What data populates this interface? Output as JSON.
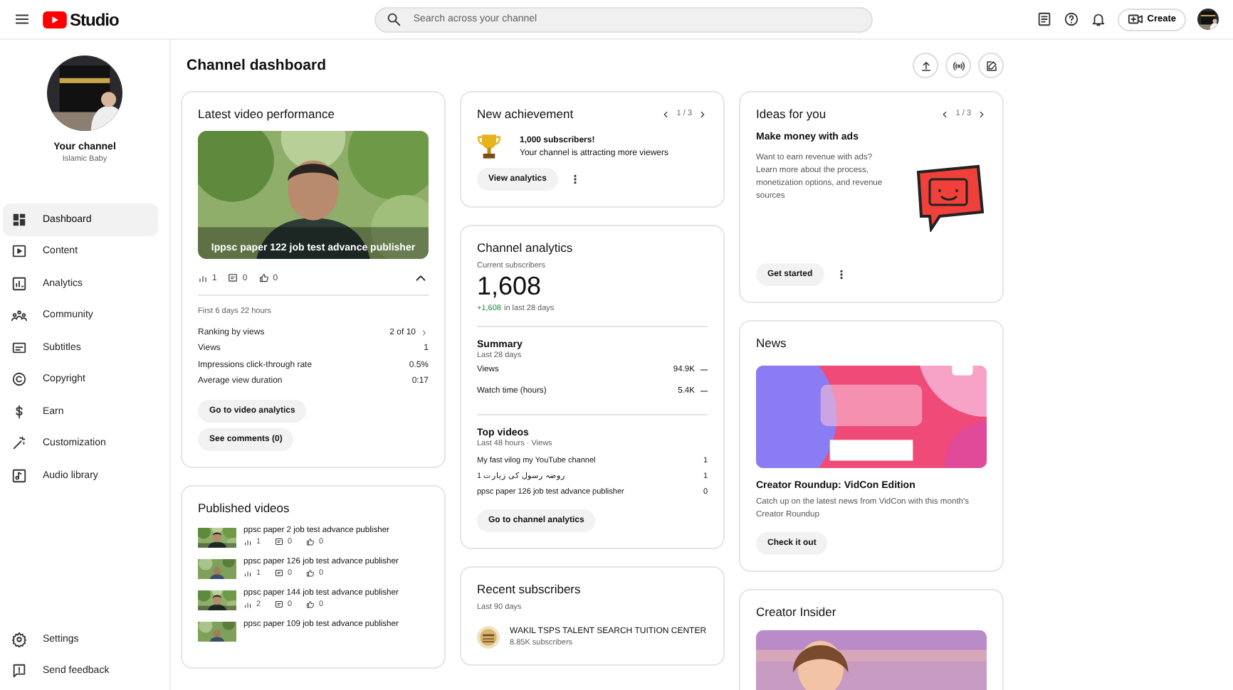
{
  "topbar": {
    "logo": "Studio",
    "search": {
      "placeholder": "Search across your channel"
    },
    "create": "Create"
  },
  "sidebar": {
    "channel_label": "Your channel",
    "channel_name": "Islamic Baby",
    "items": [
      {
        "label": "Dashboard",
        "selected": true
      },
      {
        "label": "Content",
        "selected": false
      },
      {
        "label": "Analytics",
        "selected": false
      },
      {
        "label": "Community",
        "selected": false
      },
      {
        "label": "Subtitles",
        "selected": false
      },
      {
        "label": "Copyright",
        "selected": false
      },
      {
        "label": "Earn",
        "selected": false
      },
      {
        "label": "Customization",
        "selected": false
      },
      {
        "label": "Audio library",
        "selected": false
      }
    ],
    "footer_items": [
      {
        "label": "Settings",
        "selected": false
      },
      {
        "label": "Send feedback",
        "selected": false
      }
    ]
  },
  "page_title": "Channel dashboard",
  "latest_video": {
    "title": "Latest video performance",
    "video_title": "Ippsc paper 122 job test advance publisher",
    "stats": [
      "1",
      "0",
      "0"
    ],
    "period": "First 6 days 22 hours",
    "metrics": [
      {
        "label": "Ranking by views",
        "value": "2 of 10",
        "link": true
      },
      {
        "label": "Views",
        "value": "1",
        "link": false
      },
      {
        "label": "Impressions click-through rate",
        "value": "0.5%",
        "link": false
      },
      {
        "label": "Average view duration",
        "value": "0:17",
        "link": false
      }
    ],
    "buttons": [
      "Go to video analytics",
      "See comments (0)"
    ]
  },
  "published": {
    "title": "Published videos",
    "videos": [
      {
        "title": "ppsc paper 2 job test advance publisher",
        "stats": [
          "1",
          "0",
          "0"
        ]
      },
      {
        "title": "ppsc paper 126 job test advance publisher",
        "stats": [
          "1",
          "0",
          "0"
        ]
      },
      {
        "title": "ppsc paper 144 job test advance publisher",
        "stats": [
          "2",
          "0",
          "0"
        ]
      },
      {
        "title": "ppsc paper 109 job test advance publisher"
      }
    ]
  },
  "achievement": {
    "title": "New achievement",
    "pager": "1 / 3",
    "headline": "1,000 subscribers!",
    "text": "Your channel is attracting more viewers",
    "button": "View analytics"
  },
  "analytics": {
    "title": "Channel analytics",
    "subs_label": "Current subscribers",
    "subs": "1,608",
    "change": "+1,608",
    "change_text": "in last 28 days",
    "summary_title": "Summary",
    "summary_period": "Last 28 days",
    "summary": [
      {
        "label": "Views",
        "value": "94.9K"
      },
      {
        "label": "Watch time (hours)",
        "value": "5.4K"
      }
    ],
    "top_title": "Top videos",
    "top_period": "Last 48 hours · Views",
    "top": [
      {
        "title": "My fast vilog my YouTube channel",
        "value": "1"
      },
      {
        "title": "1 روضہ رسول کی زیارت",
        "value": "1"
      },
      {
        "title": "ppsc paper 126 job test advance publisher",
        "value": "0"
      }
    ],
    "button": "Go to channel analytics"
  },
  "recent_subscribers": {
    "title": "Recent subscribers",
    "period": "Last 90 days",
    "subscribers": [
      {
        "name": "WAKIL TSPS TALENT SEARCH TUITION CENTER",
        "count": "8.85K subscribers"
      }
    ]
  },
  "ideas": {
    "title": "Ideas for you",
    "pager": "1 / 3",
    "headline": "Make money with ads",
    "text": "Want to earn revenue with ads? Learn more about the process, monetization options, and revenue sources",
    "button": "Get started"
  },
  "news": {
    "title": "News",
    "headline": "Creator Roundup: VidCon Edition",
    "text": "Catch up on the latest news from VidCon with this month's Creator Roundup",
    "button": "Check it out"
  },
  "creator_insider": {
    "title": "Creator Insider"
  }
}
